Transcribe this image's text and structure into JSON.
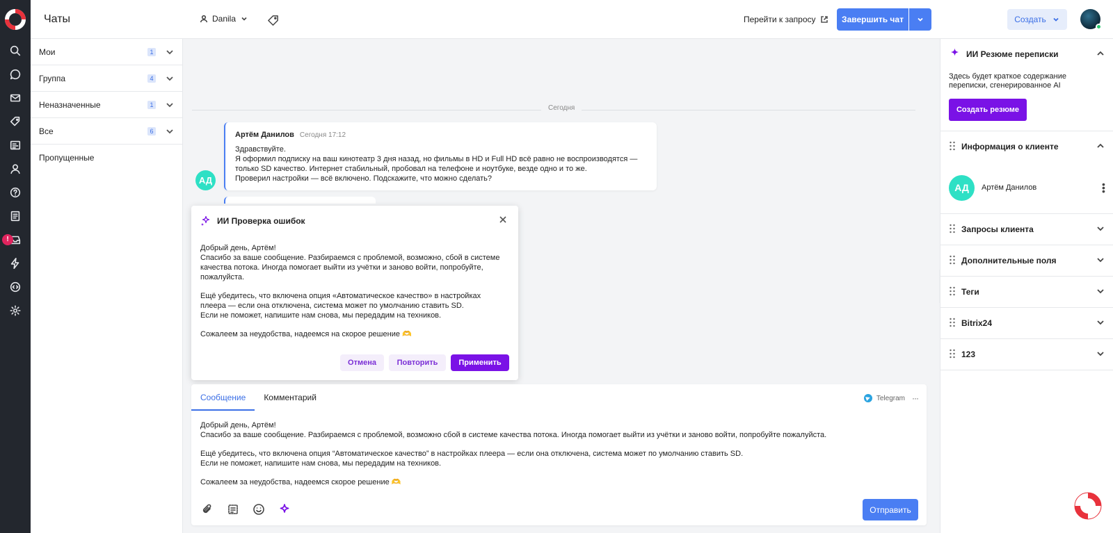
{
  "header": {
    "title": "Чаты",
    "user": "Danila",
    "goto_request": "Перейти к запросу",
    "finish_chat": "Завершить чат",
    "create": "Создать"
  },
  "colors": {
    "accent": "#4a7ef3",
    "ai_purple": "#7a12e6",
    "rail_bg": "#23272e",
    "avatar_teal": "#2ee0c5"
  },
  "sidebar": {
    "icons": [
      "search-icon",
      "chat-bubble-icon",
      "mail-icon",
      "tag-icon",
      "knowledge-icon",
      "user-icon",
      "help-icon",
      "document-icon",
      "inbox-icon",
      "lightning-icon",
      "code-icon",
      "settings-icon"
    ],
    "alert_badge": "!"
  },
  "chat_list": {
    "items": [
      {
        "label": "Мои",
        "count": "1"
      },
      {
        "label": "Группа",
        "count": "4"
      },
      {
        "label": "Неназначенные",
        "count": "1"
      },
      {
        "label": "Все",
        "count": "6"
      },
      {
        "label": "Пропущенные"
      }
    ]
  },
  "chat": {
    "date": "Сегодня",
    "sender_initials": "АД",
    "message": {
      "author": "Артём Данилов",
      "time": "Сегодня 17:12",
      "lines": [
        "Здравствуйте.",
        "Я оформил подписку на ваш кинотеатр 3 дня назад, но фильмы в HD и Full HD всё равно не воспроизводятся —",
        "только SD качество. Интернет стабильный, пробовал на телефоне и ноутбуке, везде одно и то же.",
        "Проверил настройки — всё включено. Подскажите, что можно сделать?"
      ]
    }
  },
  "ai_check": {
    "title": "ИИ Проверка ошибок",
    "paragraphs": [
      [
        "Добрый день, Артём!",
        "Спасибо за ваше сообщение. Разбираемся с проблемой, возможно, сбой в системе",
        "качества потока. Иногда помогает выйти из учётки и заново войти, попробуйте,",
        "пожалуйста."
      ],
      [
        "Ещё убедитесь, что включена опция «Автоматическое качество» в настройках",
        "плеера — если она отключена, система может по умолчанию ставить SD.",
        "Если не поможет, напишите нам снова, мы передадим на техников."
      ],
      [
        "Сожалеем за неудобства, надеемся на скорое решение 🫶"
      ]
    ],
    "cancel": "Отмена",
    "retry": "Повторить",
    "apply": "Применить"
  },
  "composer": {
    "tabs": [
      "Сообщение",
      "Комментарий"
    ],
    "channel": "Telegram",
    "more": "···",
    "paragraphs": [
      [
        "Добрый день, Артём!",
        "Спасибо за ваше сообщение. Разбираемся с проблемой, возможно сбой в системе качества потока. Иногда помогает выйти из учётки и заново войти, попробуйте пожалуйста."
      ],
      [
        "Ещё убедитесь, что включена опция “Автоматическое качество” в настройках плеера — если она отключена, система может по умолчанию ставить SD.",
        "Если не поможет, напишите нам снова, мы передадим на техников."
      ],
      [
        "Сожалеем за неудобства, надеемся скорое решение 🫶"
      ]
    ],
    "send": "Отправить"
  },
  "right_panel": {
    "summary_title": "ИИ Резюме переписки",
    "summary_text": "Здесь будет краткое содержание переписки, сгенерированное AI",
    "summary_button": "Создать резюме",
    "client_title": "Информация о клиенте",
    "client_initials": "АД",
    "client_name": "Артём Данилов",
    "sections": [
      "Запросы клиента",
      "Дополнительные поля",
      "Теги",
      "Bitrix24",
      "123"
    ]
  }
}
